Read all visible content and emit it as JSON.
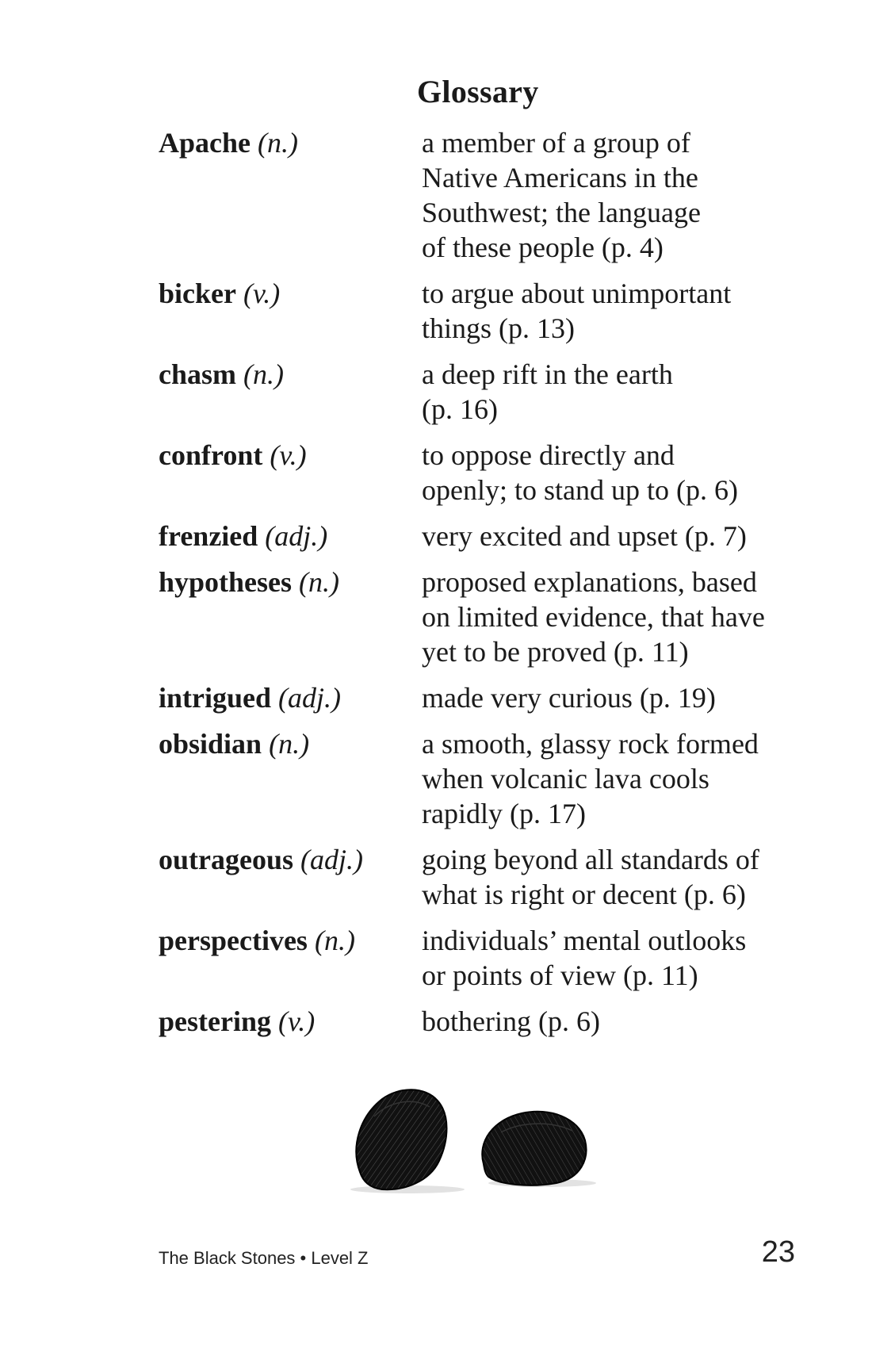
{
  "page": {
    "title": "Glossary",
    "footer_text": "The Black Stones • Level Z",
    "page_number": "23"
  },
  "glossary": [
    {
      "term": "Apache",
      "pos": "(n.)",
      "definition_lines": [
        "a member of a group of",
        "Native Americans in the",
        "Southwest; the language",
        "of these people (p. 4)"
      ]
    },
    {
      "term": "bicker",
      "pos": "(v.)",
      "definition_lines": [
        "to argue about unimportant",
        "things (p. 13)"
      ]
    },
    {
      "term": "chasm",
      "pos": "(n.)",
      "definition_lines": [
        "a deep rift in the earth",
        "(p. 16)"
      ]
    },
    {
      "term": "confront",
      "pos": "(v.)",
      "definition_lines": [
        "to oppose directly and",
        "openly; to stand up to (p. 6)"
      ]
    },
    {
      "term": "frenzied",
      "pos": "(adj.)",
      "definition_lines": [
        "very excited and upset (p. 7)"
      ]
    },
    {
      "term": "hypotheses",
      "pos": "(n.)",
      "definition_lines": [
        "proposed explanations, based",
        "on limited evidence, that have",
        "yet to be proved (p. 11)"
      ]
    },
    {
      "term": "intrigued",
      "pos": "(adj.)",
      "definition_lines": [
        "made very curious (p. 19)"
      ]
    },
    {
      "term": "obsidian",
      "pos": "(n.)",
      "definition_lines": [
        "a smooth, glassy rock formed",
        "when volcanic lava cools",
        "rapidly (p. 17)"
      ]
    },
    {
      "term": "outrageous",
      "pos": "(adj.)",
      "definition_lines": [
        "going beyond all standards of",
        "what is right or decent (p. 6)"
      ]
    },
    {
      "term": "perspectives",
      "pos": "(n.)",
      "definition_lines": [
        "individuals’ mental outlooks",
        "or points of view (p. 11)"
      ]
    },
    {
      "term": "pestering",
      "pos": "(v.)",
      "definition_lines": [
        "bothering (p. 6)"
      ]
    }
  ],
  "illustration": {
    "icon": "black-stones-illustration",
    "color": "#111111"
  }
}
